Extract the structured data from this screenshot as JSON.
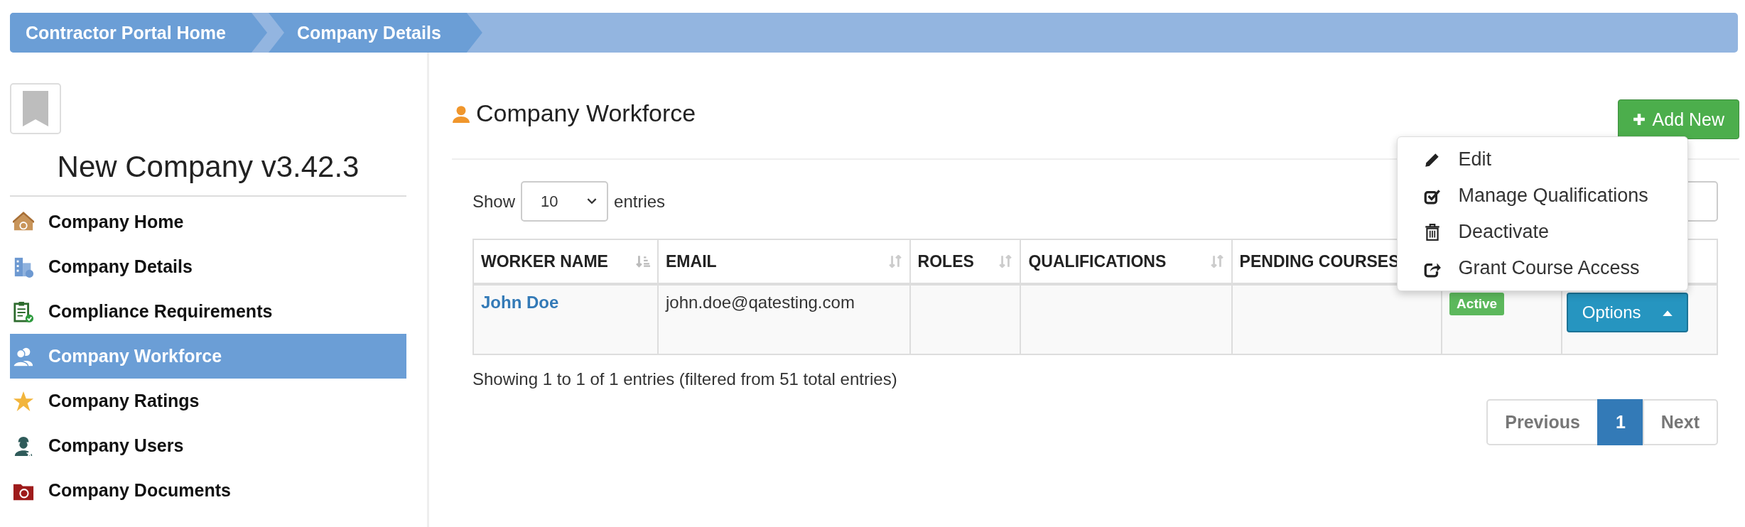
{
  "breadcrumb": [
    {
      "label": "Contractor Portal Home"
    },
    {
      "label": "Company Details"
    }
  ],
  "sidebar": {
    "company_name": "New Company v3.42.3",
    "items": [
      {
        "label": "Company Home",
        "kind": "home",
        "selected": false
      },
      {
        "label": "Company Details",
        "kind": "building",
        "selected": false
      },
      {
        "label": "Compliance Requirements",
        "kind": "clipboard",
        "selected": false
      },
      {
        "label": "Company Workforce",
        "kind": "workers",
        "selected": true
      },
      {
        "label": "Company Ratings",
        "kind": "star",
        "selected": false
      },
      {
        "label": "Company Users",
        "kind": "user",
        "selected": false
      },
      {
        "label": "Company Documents",
        "kind": "folder",
        "selected": false
      }
    ]
  },
  "main": {
    "title": "Company Workforce",
    "add_button": "Add New",
    "length": {
      "before": "Show",
      "value": "10",
      "after": "entries"
    },
    "table": {
      "columns": [
        {
          "label": "WORKER NAME",
          "sorted": true
        },
        {
          "label": "EMAIL",
          "sorted": false
        },
        {
          "label": "ROLES",
          "sorted": false
        },
        {
          "label": "QUALIFICATIONS",
          "sorted": false
        },
        {
          "label": "PENDING COURSES"
        }
      ],
      "rows": [
        {
          "worker_name": "John Doe",
          "email": "john.doe@qatesting.com",
          "status": "Active",
          "action": "Options",
          "menu_expanded": true
        }
      ]
    },
    "options_menu": [
      {
        "label": "Edit",
        "kind": "pencil"
      },
      {
        "label": "Manage Qualifications",
        "kind": "check"
      },
      {
        "label": "Deactivate",
        "kind": "trash"
      },
      {
        "label": "Grant Course Access",
        "kind": "share"
      }
    ],
    "info": "Showing 1 to 1 of 1 entries (filtered from 51 total entries)",
    "pagination": [
      {
        "label": "Previous",
        "selected": false
      },
      {
        "label": "1",
        "selected": true
      },
      {
        "label": "Next",
        "selected": false
      }
    ]
  }
}
